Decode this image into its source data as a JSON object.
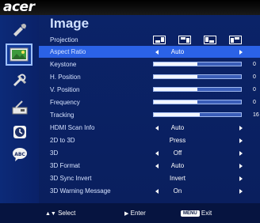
{
  "brand": {
    "logo_text": "acer"
  },
  "sidebar": {
    "items": [
      {
        "icon": "color-dropper-icon"
      },
      {
        "icon": "image-icon",
        "active": true
      },
      {
        "icon": "settings-tools-icon"
      },
      {
        "icon": "management-icon"
      },
      {
        "icon": "clock-icon"
      },
      {
        "icon": "language-icon",
        "text": "ABC"
      }
    ]
  },
  "panel": {
    "title": "Image",
    "rows": [
      {
        "label": "Projection",
        "kind": "icons",
        "icons": [
          "front-desktop-projection-icon",
          "front-ceiling-projection-icon",
          "rear-desktop-projection-icon",
          "rear-ceiling-projection-icon"
        ]
      },
      {
        "label": "Aspect Ratio",
        "kind": "select",
        "value": "Auto",
        "selected": true
      },
      {
        "label": "Keystone",
        "kind": "bar",
        "number": "0",
        "level": 0.5
      },
      {
        "label": "H. Position",
        "kind": "bar",
        "number": "0",
        "level": 0.5
      },
      {
        "label": "V. Position",
        "kind": "bar",
        "number": "0",
        "level": 0.5
      },
      {
        "label": "Frequency",
        "kind": "bar",
        "number": "0",
        "level": 0.5
      },
      {
        "label": "Tracking",
        "kind": "bar",
        "number": "16",
        "level": 0.53
      },
      {
        "label": "HDMI Scan Info",
        "kind": "select",
        "value": "Auto"
      },
      {
        "label": "2D to 3D",
        "kind": "select-noleft",
        "value": "Press"
      },
      {
        "label": "3D",
        "kind": "select",
        "value": "Off"
      },
      {
        "label": "3D Format",
        "kind": "select",
        "value": "Auto"
      },
      {
        "label": "3D Sync Invert",
        "kind": "select-noleft",
        "value": "Invert"
      },
      {
        "label": "3D Warning Message",
        "kind": "select",
        "value": "On"
      }
    ]
  },
  "footer": {
    "select_label": "Select",
    "enter_label": "Enter",
    "menu_key": "MENU",
    "exit_label": "Exit"
  },
  "colors": {
    "panel_bg": "#0a1f5e",
    "selected_row": "#2b62e6",
    "sidebar_bg": "#0c2a78"
  }
}
